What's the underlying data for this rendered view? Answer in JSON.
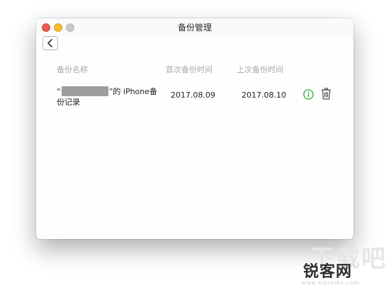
{
  "window": {
    "title": "备份管理"
  },
  "table": {
    "headers": {
      "name": "备份名称",
      "first_backup": "首次备份时间",
      "last_backup": "上次备份时间"
    },
    "rows": [
      {
        "name_prefix": "“",
        "name_suffix": "”的 iPhone备",
        "name_line2": "份记录",
        "first_backup": "2017.08.09",
        "last_backup": "2017.08.10"
      }
    ]
  },
  "icons": {
    "back": "chevron-left-icon",
    "info": "info-icon",
    "trash": "trash-icon"
  },
  "colors": {
    "close": "#ee5a52",
    "minimize": "#f5bd2f",
    "maximize": "#c9c9c9",
    "info_green": "#2bb02b"
  },
  "watermark": {
    "top": "下载吧",
    "main": "锐客网",
    "url": "www.xiazaiba.com"
  }
}
